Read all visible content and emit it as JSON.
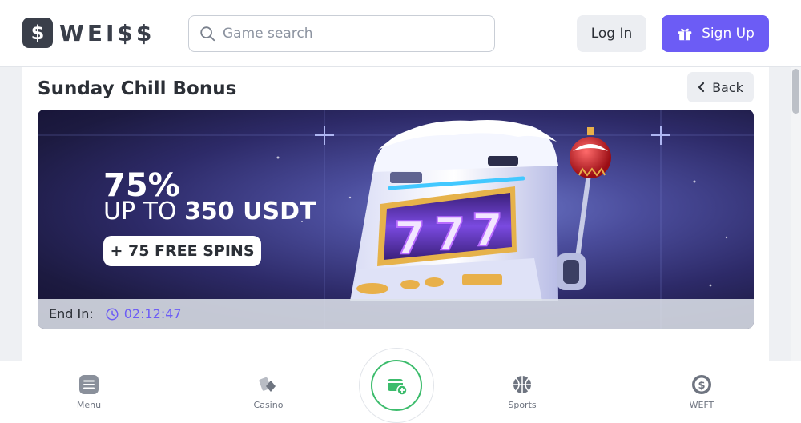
{
  "brand": {
    "logo_mark": "$",
    "name": "WEI$$"
  },
  "header": {
    "search_placeholder": "Game search",
    "login_label": "Log In",
    "signup_label": "Sign Up"
  },
  "page": {
    "title": "Sunday Chill Bonus",
    "back_label": "Back"
  },
  "banner": {
    "percent": "75%",
    "up_to_prefix": "UP TO ",
    "amount": "350 USDT",
    "free_spins": "+ 75 FREE SPINS",
    "slot_reels": [
      "7",
      "7",
      "7"
    ],
    "end_label": "End In:",
    "countdown": "02:12:47"
  },
  "bottom_nav": [
    {
      "label": "Menu",
      "icon": "menu-icon"
    },
    {
      "label": "Casino",
      "icon": "cards-icon"
    },
    {
      "label": "",
      "icon": "wallet-add-icon"
    },
    {
      "label": "Sports",
      "icon": "basketball-icon"
    },
    {
      "label": "WEFT",
      "icon": "weft-coin-icon"
    }
  ],
  "colors": {
    "accent": "#6c5cf5",
    "green": "#3cbc6c",
    "text_dark": "#2b2f36",
    "button_gray": "#eceef2"
  }
}
